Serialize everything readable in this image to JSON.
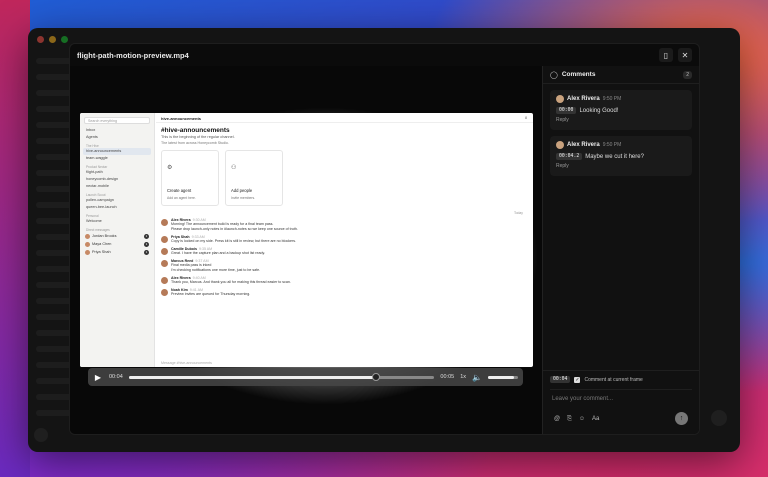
{
  "modal": {
    "title": "flight-path-motion-preview.mp4",
    "panel_toggle_icon": "sidebar-icon",
    "close_icon": "close-icon"
  },
  "video": {
    "current_time": "00:04",
    "duration": "00:05",
    "speed": "1x",
    "progress": 0.81,
    "volume": 0.85
  },
  "frame": {
    "search_placeholder": "Search everything",
    "nav": [
      "Inbox",
      "Agents"
    ],
    "section_hive": "The Hive",
    "channels": [
      "hive-announcements",
      "team-waggle"
    ],
    "section_products": "Product Nectar",
    "product_channels": [
      "flight-path",
      "honeycomb-design",
      "nectar-mobile"
    ],
    "section_launch": "Launch Scout",
    "launch_channels": [
      "pollen-campaign",
      "queen-bee-launch"
    ],
    "section_personal": "Personal",
    "personal": [
      "Welcome"
    ],
    "section_dm": "Direct messages",
    "dms": [
      {
        "name": "Jordan Brooks",
        "count": "1"
      },
      {
        "name": "Maya Chen",
        "count": "1"
      },
      {
        "name": "Priya Shah",
        "count": "1"
      }
    ],
    "channel_header": "hive-announcements",
    "channel_header_right": "8",
    "channel_title": "#hive-announcements",
    "channel_sub": "This is the beginning of the regular channel.",
    "channel_sub2": "The latest from across Honeycomb Studio.",
    "cards": [
      {
        "title": "Create agent",
        "sub": "Add an agent here."
      },
      {
        "title": "Add people",
        "sub": "Invite members."
      }
    ],
    "today": "Today",
    "messages": [
      {
        "who": "Alex Rivera",
        "time": "9:30 AM",
        "lines": [
          "Morning! The announcement build is ready for a final team pass.",
          "Please drop launch-only notes in #launch-notes so we keep one source of truth."
        ]
      },
      {
        "who": "Priya Shah",
        "time": "9:33 AM",
        "lines": [
          "Copy is locked on my side. Press kit is still in review, but there are no blockers."
        ]
      },
      {
        "who": "Camille Dubois",
        "time": "9:35 AM",
        "lines": [
          "Great. I have the capture plan and a backup shot list ready."
        ]
      },
      {
        "who": "Marcus Reed",
        "time": "9:37 AM",
        "lines": [
          "Final media pass is inked",
          "I'm checking notifications one more time, just to be safe."
        ]
      },
      {
        "who": "Alex Rivera",
        "time": "9:40 AM",
        "lines": [
          "Thank you, Marcus. And thank you all for making this thread easier to scan."
        ]
      },
      {
        "who": "Noah Kim",
        "time": "9:41 AM",
        "lines": [
          "Preview invites are queued for Thursday morning."
        ]
      }
    ],
    "compose_placeholder": "Message #hive-announcements"
  },
  "reactions": [
    "😂",
    "😡",
    "😮",
    "🙌",
    "👍",
    "👎",
    "☺"
  ],
  "comments": {
    "title": "Comments",
    "count": "2",
    "items": [
      {
        "author": "Alex Rivera",
        "time": "9:50 PM",
        "stamp": "00:00",
        "text": "Looking Good!",
        "reply": "Reply"
      },
      {
        "author": "Alex Rivera",
        "time": "9:50 PM",
        "stamp": "00:04.2",
        "text": "Maybe we cut it here?",
        "reply": "Reply"
      }
    ],
    "footer_stamp": "00:04",
    "footer_label": "Comment at current frame",
    "input_placeholder": "Leave your comment...",
    "tool_aa": "Aa"
  }
}
